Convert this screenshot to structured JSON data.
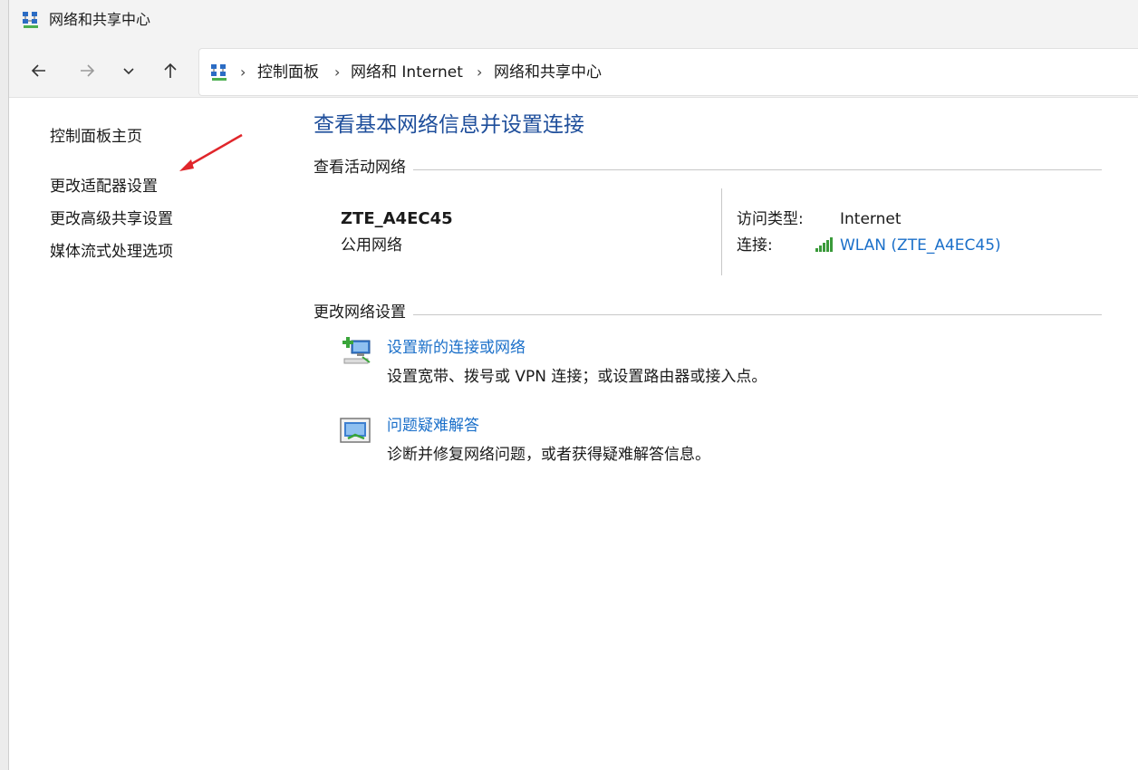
{
  "window": {
    "title": "网络和共享中心"
  },
  "address": {
    "crumbs": [
      "控制面板",
      "网络和 Internet",
      "网络和共享中心"
    ],
    "separator": "›"
  },
  "sidebar": {
    "items": [
      {
        "label": "控制面板主页"
      },
      {
        "label": "更改适配器设置"
      },
      {
        "label": "更改高级共享设置"
      },
      {
        "label": "媒体流式处理选项"
      }
    ]
  },
  "main": {
    "title": "查看基本网络信息并设置连接",
    "active_section": "查看活动网络",
    "network": {
      "name": "ZTE_A4EC45",
      "type": "公用网络",
      "access_label": "访问类型:",
      "access_value": "Internet",
      "connection_label": "连接:",
      "connection_value": "WLAN (ZTE_A4EC45)"
    },
    "change_section": "更改网络设置",
    "tasks": [
      {
        "link": "设置新的连接或网络",
        "description": "设置宽带、拨号或 VPN 连接；或设置路由器或接入点。",
        "icon": "new-connection-icon"
      },
      {
        "link": "问题疑难解答",
        "description": "诊断并修复网络问题，或者获得疑难解答信息。",
        "icon": "troubleshoot-icon"
      }
    ]
  },
  "colors": {
    "heading_blue": "#1e4e9b",
    "link_blue": "#1a6fc9",
    "annotation_red": "#e0262b"
  }
}
